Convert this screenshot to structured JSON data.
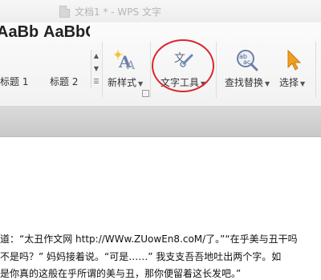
{
  "window": {
    "title": "文档1 * - WPS 文字"
  },
  "ribbon": {
    "styles": [
      {
        "sample": "AaBb",
        "name": "标题 1"
      },
      {
        "sample": "AaBbC",
        "name": "标题 2"
      }
    ],
    "new_style": {
      "label": "新样式",
      "icon": "new-style-icon"
    },
    "text_tools": {
      "label": "文字工具",
      "icon": "text-tools-icon"
    },
    "find_replace": {
      "label": "查找替换",
      "icon": "find-replace-icon"
    },
    "select": {
      "label": "选择",
      "icon": "select-cursor-icon"
    }
  },
  "document": {
    "lines": [
      "道：“太丑作文网 http://WWw.ZUowEn8.coM/了。”“在乎美与丑干吗",
      "不是吗？” 妈妈接着说。“可是……” 我支支吾吾地吐出两个字。如",
      "是你真的这般在乎所谓的美与丑，那你便留着这长发吧。”"
    ]
  },
  "colors": {
    "annotation_circle": "#d9282e",
    "select_cursor": "#f0a020"
  }
}
